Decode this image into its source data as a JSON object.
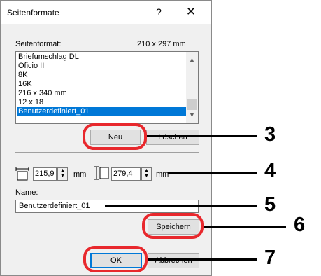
{
  "dialog": {
    "title": "Seitenformate",
    "help_glyph": "?",
    "close_glyph": "✕"
  },
  "format": {
    "label": "Seitenformat:",
    "size_readout": "210 x 297 mm",
    "items": [
      {
        "label": "Briefumschlag DL"
      },
      {
        "label": "Oficio II"
      },
      {
        "label": "8K"
      },
      {
        "label": "16K"
      },
      {
        "label": "216 x 340 mm"
      },
      {
        "label": "12 x 18"
      },
      {
        "label": "Benutzerdefiniert_01",
        "selected": true
      }
    ]
  },
  "buttons": {
    "new": "Neu",
    "delete": "Löschen",
    "save": "Speichern",
    "ok": "OK",
    "cancel": "Abbrechen"
  },
  "size": {
    "width_value": "215,9",
    "width_unit": "mm",
    "height_value": "279,4",
    "height_unit": "mm"
  },
  "name": {
    "label": "Name:",
    "value": "Benutzerdefiniert_01"
  },
  "callouts": [
    "3",
    "4",
    "5",
    "6",
    "7"
  ],
  "colors": {
    "highlight": "#e8282d",
    "selection": "#0078d7"
  }
}
